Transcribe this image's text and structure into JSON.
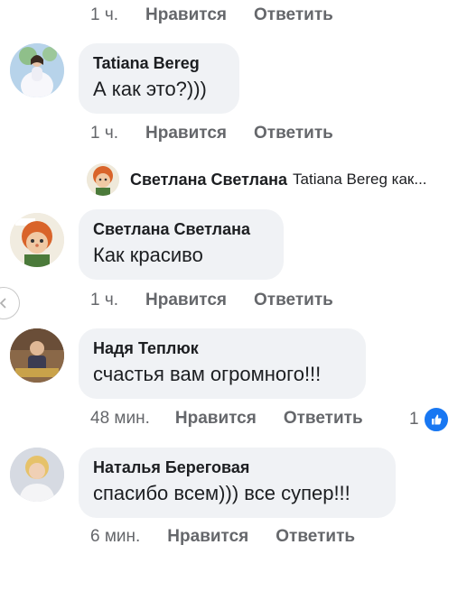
{
  "top_actions": {
    "time": "1 ч.",
    "like": "Нравится",
    "reply": "Ответить"
  },
  "comments": [
    {
      "author": "Tatiana Bereg",
      "text": "А как это?)))",
      "time": "1 ч.",
      "like": "Нравится",
      "reply": "Ответить"
    },
    {
      "author": "Светлана Светлана",
      "text": "Как красиво",
      "time": "1 ч.",
      "like": "Нравится",
      "reply": "Ответить"
    },
    {
      "author": "Надя Теплюк",
      "text": "счастья вам огромного!!!",
      "time": "48 мин.",
      "like": "Нравится",
      "reply": "Ответить",
      "reaction_count": "1"
    },
    {
      "author": "Наталья Береговая",
      "text": "спасибо всем))) все супер!!!",
      "time": "6 мин.",
      "like": "Нравится",
      "reply": "Ответить"
    }
  ],
  "collapsed_reply": {
    "author": "Светлана Светлана",
    "snippet": "Tatiana Bereg как..."
  },
  "colors": {
    "bubble": "#f0f2f5",
    "meta": "#65676b",
    "like_blue": "#1877f2"
  }
}
